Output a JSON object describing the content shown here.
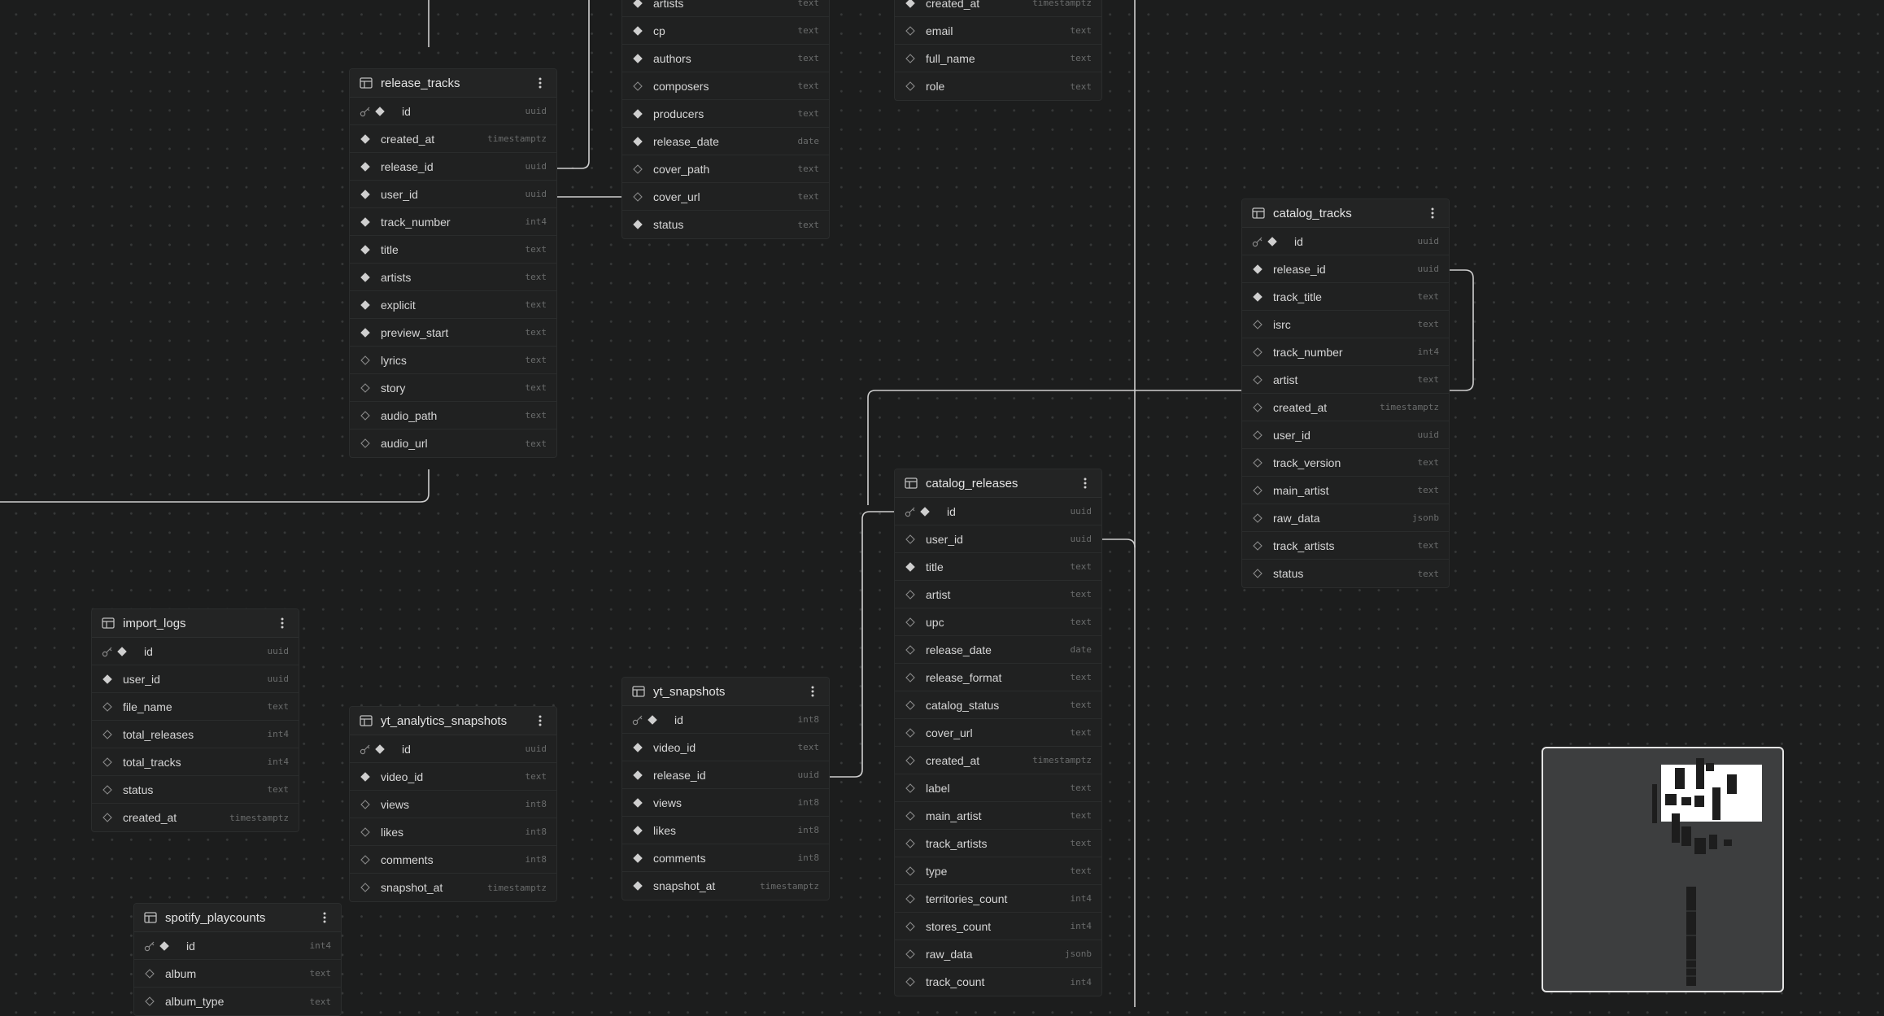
{
  "tables": [
    {
      "id": "release_tracks",
      "name": "release_tracks",
      "show_header": true,
      "columns": [
        {
          "name": "id",
          "type": "uuid",
          "pk": true,
          "required": true
        },
        {
          "name": "created_at",
          "type": "timestamptz",
          "required": true
        },
        {
          "name": "release_id",
          "type": "uuid",
          "required": true
        },
        {
          "name": "user_id",
          "type": "uuid",
          "required": true
        },
        {
          "name": "track_number",
          "type": "int4",
          "required": true
        },
        {
          "name": "title",
          "type": "text",
          "required": true
        },
        {
          "name": "artists",
          "type": "text",
          "required": true
        },
        {
          "name": "explicit",
          "type": "text",
          "required": true
        },
        {
          "name": "preview_start",
          "type": "text",
          "required": true
        },
        {
          "name": "lyrics",
          "type": "text",
          "required": false
        },
        {
          "name": "story",
          "type": "text",
          "required": false
        },
        {
          "name": "audio_path",
          "type": "text",
          "required": false
        },
        {
          "name": "audio_url",
          "type": "text",
          "required": false
        }
      ]
    },
    {
      "id": "releases_partial",
      "name": "",
      "show_header": false,
      "columns": [
        {
          "name": "artists",
          "type": "text",
          "required": true
        },
        {
          "name": "cp",
          "type": "text",
          "required": true
        },
        {
          "name": "authors",
          "type": "text",
          "required": true
        },
        {
          "name": "composers",
          "type": "text",
          "required": false
        },
        {
          "name": "producers",
          "type": "text",
          "required": true
        },
        {
          "name": "release_date",
          "type": "date",
          "required": true
        },
        {
          "name": "cover_path",
          "type": "text",
          "required": false
        },
        {
          "name": "cover_url",
          "type": "text",
          "required": false
        },
        {
          "name": "status",
          "type": "text",
          "required": true
        }
      ]
    },
    {
      "id": "users_partial",
      "name": "",
      "show_header": false,
      "columns": [
        {
          "name": "created_at",
          "type": "timestamptz",
          "required": true
        },
        {
          "name": "email",
          "type": "text",
          "required": false
        },
        {
          "name": "full_name",
          "type": "text",
          "required": false
        },
        {
          "name": "role",
          "type": "text",
          "required": false
        }
      ]
    },
    {
      "id": "catalog_tracks",
      "name": "catalog_tracks",
      "show_header": true,
      "columns": [
        {
          "name": "id",
          "type": "uuid",
          "pk": true,
          "required": true
        },
        {
          "name": "release_id",
          "type": "uuid",
          "required": true
        },
        {
          "name": "track_title",
          "type": "text",
          "required": true
        },
        {
          "name": "isrc",
          "type": "text",
          "required": false
        },
        {
          "name": "track_number",
          "type": "int4",
          "required": false
        },
        {
          "name": "artist",
          "type": "text",
          "required": false
        },
        {
          "name": "created_at",
          "type": "timestamptz",
          "required": false
        },
        {
          "name": "user_id",
          "type": "uuid",
          "required": false
        },
        {
          "name": "track_version",
          "type": "text",
          "required": false
        },
        {
          "name": "main_artist",
          "type": "text",
          "required": false
        },
        {
          "name": "raw_data",
          "type": "jsonb",
          "required": false
        },
        {
          "name": "track_artists",
          "type": "text",
          "required": false
        },
        {
          "name": "status",
          "type": "text",
          "required": false
        }
      ]
    },
    {
      "id": "catalog_releases",
      "name": "catalog_releases",
      "show_header": true,
      "columns": [
        {
          "name": "id",
          "type": "uuid",
          "pk": true,
          "required": true
        },
        {
          "name": "user_id",
          "type": "uuid",
          "required": false
        },
        {
          "name": "title",
          "type": "text",
          "required": true
        },
        {
          "name": "artist",
          "type": "text",
          "required": false
        },
        {
          "name": "upc",
          "type": "text",
          "required": false
        },
        {
          "name": "release_date",
          "type": "date",
          "required": false
        },
        {
          "name": "release_format",
          "type": "text",
          "required": false
        },
        {
          "name": "catalog_status",
          "type": "text",
          "required": false
        },
        {
          "name": "cover_url",
          "type": "text",
          "required": false
        },
        {
          "name": "created_at",
          "type": "timestamptz",
          "required": false
        },
        {
          "name": "label",
          "type": "text",
          "required": false
        },
        {
          "name": "main_artist",
          "type": "text",
          "required": false
        },
        {
          "name": "track_artists",
          "type": "text",
          "required": false
        },
        {
          "name": "type",
          "type": "text",
          "required": false
        },
        {
          "name": "territories_count",
          "type": "int4",
          "required": false
        },
        {
          "name": "stores_count",
          "type": "int4",
          "required": false
        },
        {
          "name": "raw_data",
          "type": "jsonb",
          "required": false
        },
        {
          "name": "track_count",
          "type": "int4",
          "required": false
        }
      ]
    },
    {
      "id": "import_logs",
      "name": "import_logs",
      "show_header": true,
      "columns": [
        {
          "name": "id",
          "type": "uuid",
          "pk": true,
          "required": true
        },
        {
          "name": "user_id",
          "type": "uuid",
          "required": true
        },
        {
          "name": "file_name",
          "type": "text",
          "required": false
        },
        {
          "name": "total_releases",
          "type": "int4",
          "required": false
        },
        {
          "name": "total_tracks",
          "type": "int4",
          "required": false
        },
        {
          "name": "status",
          "type": "text",
          "required": false
        },
        {
          "name": "created_at",
          "type": "timestamptz",
          "required": false
        }
      ]
    },
    {
      "id": "yt_analytics_snapshots",
      "name": "yt_analytics_snapshots",
      "show_header": true,
      "columns": [
        {
          "name": "id",
          "type": "uuid",
          "pk": true,
          "required": true
        },
        {
          "name": "video_id",
          "type": "text",
          "required": true
        },
        {
          "name": "views",
          "type": "int8",
          "required": false
        },
        {
          "name": "likes",
          "type": "int8",
          "required": false
        },
        {
          "name": "comments",
          "type": "int8",
          "required": false
        },
        {
          "name": "snapshot_at",
          "type": "timestamptz",
          "required": false
        }
      ]
    },
    {
      "id": "yt_snapshots",
      "name": "yt_snapshots",
      "show_header": true,
      "columns": [
        {
          "name": "id",
          "type": "int8",
          "pk": true,
          "required": true
        },
        {
          "name": "video_id",
          "type": "text",
          "required": true
        },
        {
          "name": "release_id",
          "type": "uuid",
          "required": true
        },
        {
          "name": "views",
          "type": "int8",
          "required": true
        },
        {
          "name": "likes",
          "type": "int8",
          "required": true
        },
        {
          "name": "comments",
          "type": "int8",
          "required": true
        },
        {
          "name": "snapshot_at",
          "type": "timestamptz",
          "required": true
        }
      ]
    },
    {
      "id": "spotify_playcounts",
      "name": "spotify_playcounts",
      "show_header": true,
      "columns": [
        {
          "name": "id",
          "type": "int4",
          "pk": true,
          "required": true
        },
        {
          "name": "album",
          "type": "text",
          "required": false
        },
        {
          "name": "album_type",
          "type": "text",
          "required": false
        }
      ]
    }
  ],
  "colors": {
    "canvas": "#1c1d1d",
    "edge": "#cfd0d0",
    "minimap_bg": "#3d3e3f",
    "minimap_viewport": "#ffffff"
  }
}
